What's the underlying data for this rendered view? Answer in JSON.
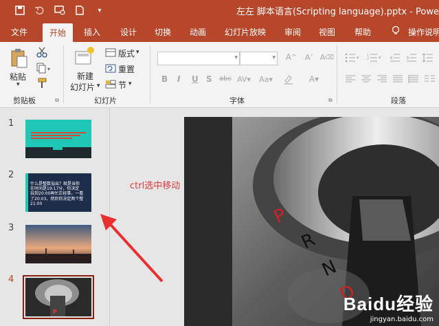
{
  "title_bar": {
    "title": "左左 脚本语言(Scripting language).pptx  -  Powe",
    "icons": [
      "save-icon",
      "undo-icon",
      "present-icon",
      "new-file-icon",
      "customize-icon"
    ]
  },
  "tabs": [
    {
      "label": "文件"
    },
    {
      "label": "开始"
    },
    {
      "label": "插入"
    },
    {
      "label": "设计"
    },
    {
      "label": "切换"
    },
    {
      "label": "动画"
    },
    {
      "label": "幻灯片放映"
    },
    {
      "label": "审阅"
    },
    {
      "label": "视图"
    },
    {
      "label": "帮助"
    },
    {
      "label": "操作说明"
    }
  ],
  "ribbon": {
    "clipboard": {
      "paste": "粘贴",
      "group": "剪贴板"
    },
    "slides": {
      "new_slide_l1": "新建",
      "new_slide_l2": "幻灯片",
      "layout": "版式",
      "reset": "重置",
      "section": "节",
      "group": "幻灯片"
    },
    "font": {
      "bold": "B",
      "italic": "I",
      "underline": "U",
      "strike": "S",
      "shadow": "abc",
      "group": "字体"
    },
    "paragraph": {
      "group": "段落"
    }
  },
  "slides": [
    {
      "number": "1"
    },
    {
      "number": "2",
      "text": "什么是整数溢出？就是当你\n在时间是19:17分，你决定\n玩到20:00再忙正经事，一看\n了20:03，然后你决定两个整\n21:00"
    },
    {
      "number": "3"
    },
    {
      "number": "4"
    }
  ],
  "annotation": "ctrl选中移动",
  "watermark": {
    "brand": "Baidu经验",
    "url": "jingyan.baidu.com"
  },
  "colors": {
    "accent": "#b7472a",
    "annotation": "#e03b3b",
    "selected_border": "#8a1f11"
  }
}
